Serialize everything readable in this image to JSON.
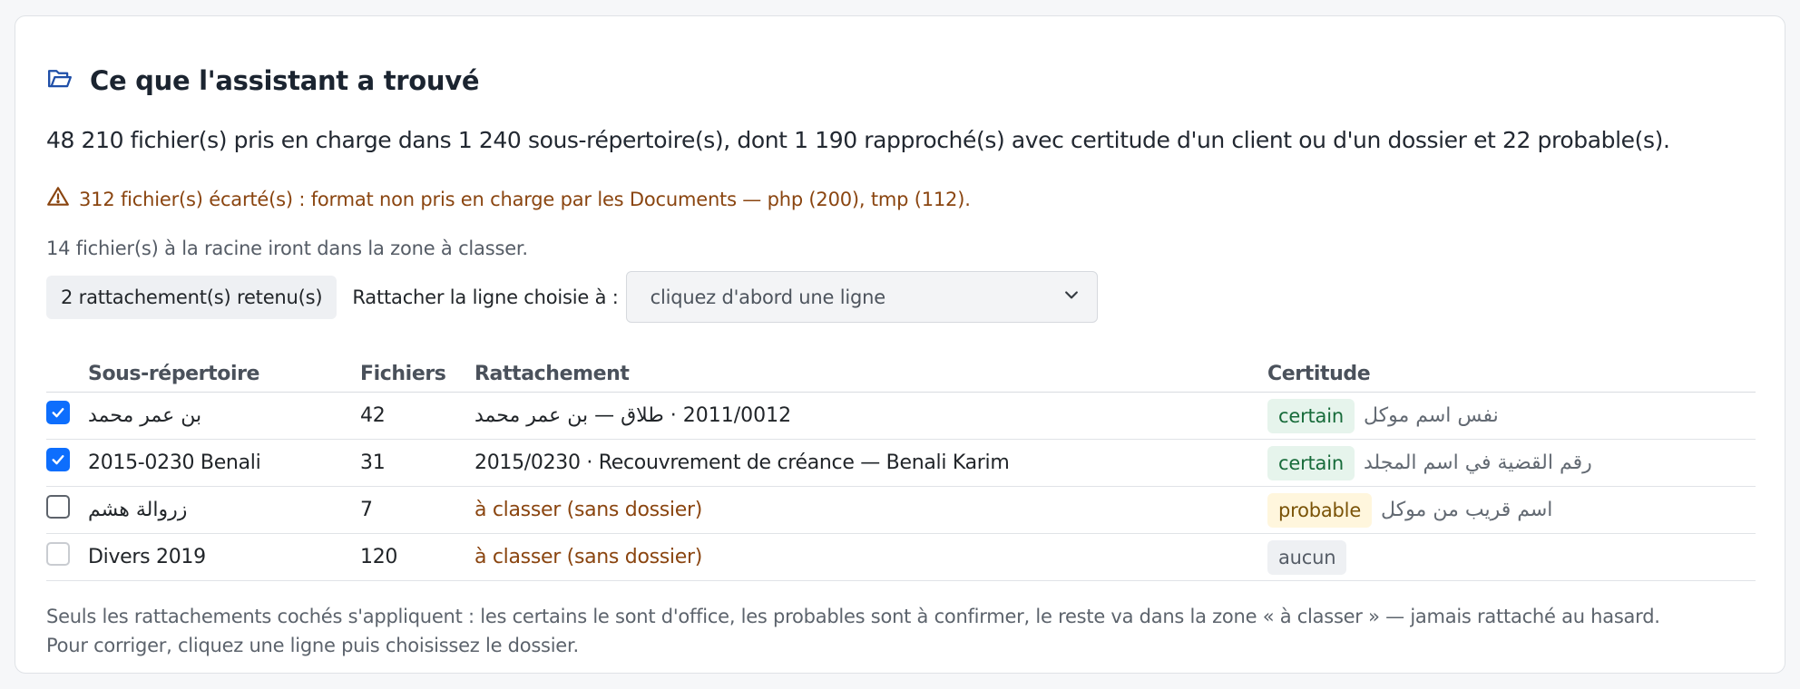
{
  "card": {
    "title": "Ce que l'assistant a trouvé",
    "summary": "48 210 fichier(s) pris en charge dans 1 240 sous-répertoire(s), dont 1 190 rapproché(s) avec certitude d'un client ou d'un dossier et 22 probable(s).",
    "warning": "312 fichier(s) écarté(s) : format non pris en charge par les Documents — php (200), tmp (112).",
    "root_note": "14 fichier(s) à la racine iront dans la zone à classer."
  },
  "controls": {
    "retained_count": "2 rattachement(s) retenu(s)",
    "attach_label": "Rattacher la ligne choisie à :",
    "select_value": "cliquez d'abord une ligne"
  },
  "table": {
    "headers": {
      "subdir": "Sous-répertoire",
      "files": "Fichiers",
      "attachment": "Rattachement",
      "certainty": "Certitude"
    },
    "rows": [
      {
        "checked": true,
        "subdir": "بن عمر محمد",
        "files": "42",
        "attachment": "2011/0012 · طلاق — بن عمر محمد",
        "certainty": "certain",
        "reason": "نفس اسم موكل"
      },
      {
        "checked": true,
        "subdir": "2015-0230 Benali",
        "files": "31",
        "attachment": "2015/0230 · Recouvrement de créance — Benali Karim",
        "certainty": "certain",
        "reason": "رقم القضية في اسم المجلد"
      },
      {
        "checked": false,
        "subdir": "زروالة هشم",
        "files": "7",
        "attachment": "à classer (sans dossier)",
        "certainty": "probable",
        "reason": "اسم قريب من موكل"
      },
      {
        "checked": false,
        "subdir": "Divers 2019",
        "files": "120",
        "attachment": "à classer (sans dossier)",
        "certainty": "aucun",
        "reason": ""
      }
    ]
  },
  "footer": {
    "line1": "Seuls les rattachements cochés s'appliquent : les certains le sont d'office, les probables sont à confirmer, le reste va dans la zone « à classer » — jamais rattaché au hasard.",
    "line2": "Pour corriger, cliquez une ligne puis choisissez le dossier."
  },
  "icons": {
    "title": "folder-open-icon",
    "warning": "warning-triangle-icon",
    "select": "chevron-down-icon",
    "check": "check-icon"
  },
  "colors": {
    "accent": "#0d6efd",
    "warning_text": "#8a4510",
    "certain_bg": "#e6f4ec",
    "certain_text": "#176b3a",
    "probable_bg": "#fff6dd",
    "probable_text": "#7a5307"
  }
}
